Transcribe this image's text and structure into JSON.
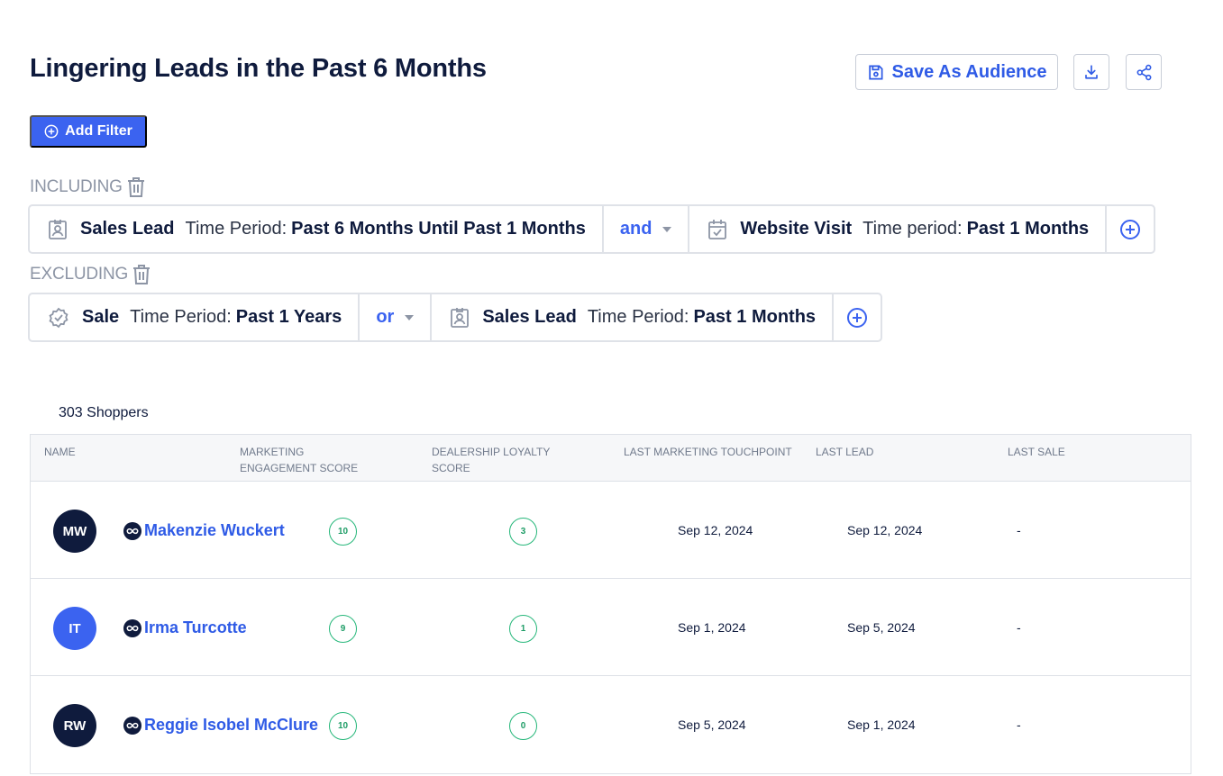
{
  "page": {
    "title": "Lingering Leads in the Past 6 Months",
    "save_label": "Save As Audience",
    "add_filter_label": "Add Filter"
  },
  "filters": {
    "including_label": "INCLUDING",
    "excluding_label": "EXCLUDING",
    "including": [
      {
        "icon": "contact-badge-icon",
        "event": "Sales Lead",
        "period_label": "Time Period:",
        "period_value": "Past 6 Months Until Past 1 Months"
      },
      {
        "icon": "calendar-check-icon",
        "event": "Website Visit",
        "period_label": "Time period:",
        "period_value": "Past 1 Months"
      }
    ],
    "including_operator": "and",
    "excluding": [
      {
        "icon": "verified-badge-icon",
        "event": "Sale",
        "period_label": "Time Period:",
        "period_value": "Past 1 Years"
      },
      {
        "icon": "contact-badge-icon",
        "event": "Sales Lead",
        "period_label": "Time Period:",
        "period_value": "Past 1 Months"
      }
    ],
    "excluding_operator": "or"
  },
  "table": {
    "count_label": "303 Shoppers",
    "headers": {
      "name": "NAME",
      "engagement_line1": "MARKETING",
      "engagement_line2": "ENGAGEMENT SCORE",
      "loyalty_line1": "DEALERSHIP LOYALTY",
      "loyalty_line2": "SCORE",
      "touchpoint": "LAST MARKETING TOUCHPOINT",
      "lead": "LAST LEAD",
      "sale": "LAST SALE"
    },
    "rows": [
      {
        "initials": "MW",
        "avatar_color": "#0f1b3d",
        "name": "Makenzie Wuckert",
        "engagement": "10",
        "loyalty": "3",
        "touchpoint": "Sep 12, 2024",
        "lead": "Sep 12, 2024",
        "sale": "-"
      },
      {
        "initials": "IT",
        "avatar_color": "#3b63f0",
        "name": "Irma Turcotte",
        "engagement": "9",
        "loyalty": "1",
        "touchpoint": "Sep 1, 2024",
        "lead": "Sep 5, 2024",
        "sale": "-"
      },
      {
        "initials": "RW",
        "avatar_color": "#0f1b3d",
        "name": "Reggie Isobel McClure",
        "engagement": "10",
        "loyalty": "0",
        "touchpoint": "Sep 5, 2024",
        "lead": "Sep 1, 2024",
        "sale": "-"
      }
    ]
  },
  "colors": {
    "accent": "#3b63f0",
    "link": "#2f5be6",
    "score_ring": "#26b77a",
    "muted": "#8d95a5"
  }
}
